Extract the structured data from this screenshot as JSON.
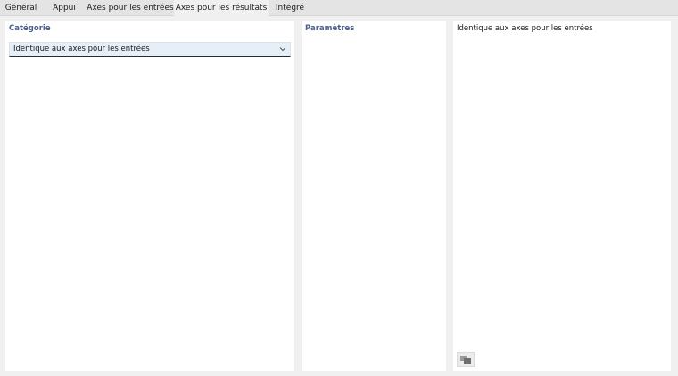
{
  "tabs": [
    {
      "label": "Général",
      "active": false
    },
    {
      "label": "Appui",
      "active": false
    },
    {
      "label": "Axes pour les entrées",
      "active": false
    },
    {
      "label": "Axes pour les résultats",
      "active": true
    },
    {
      "label": "Intégré",
      "active": false
    }
  ],
  "categorie": {
    "title": "Catégorie",
    "selected": "Identique aux axes pour les entrées"
  },
  "parametres": {
    "title": "Paramètres"
  },
  "info": {
    "description": "Identique aux axes pour les entrées"
  },
  "icons": {
    "dropdown": "chevron-down-icon",
    "corner": "image-preview-icon"
  },
  "colors": {
    "section_title": "#4b5f8c",
    "select_bg": "#e6eef8",
    "active_tab_bg": "#f0f0f0"
  }
}
